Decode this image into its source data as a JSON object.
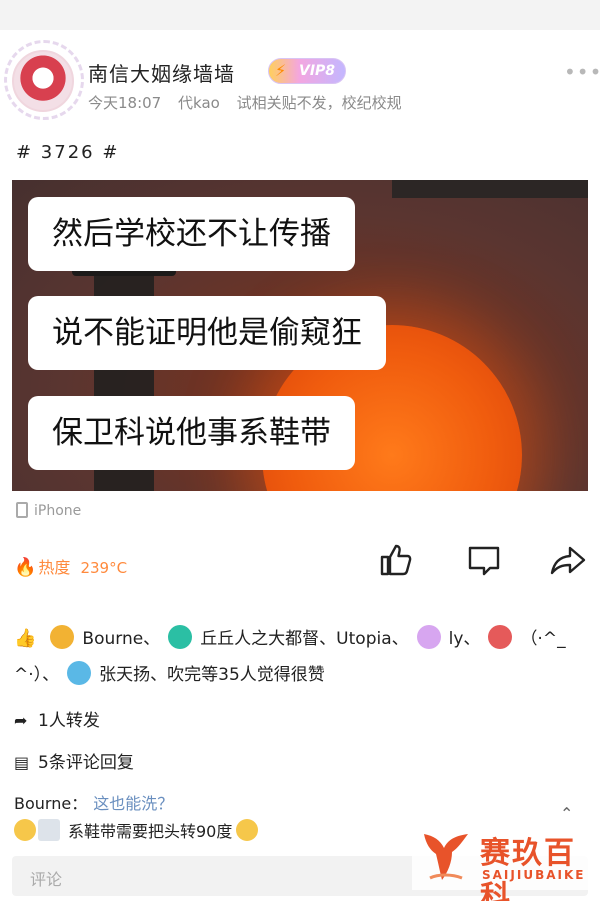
{
  "account": {
    "name": "南信大姻缘墙墙",
    "vip_label": "VIP8"
  },
  "meta": {
    "time": "今天18:07",
    "poster": "代kao",
    "note": "试相关贴不发，校纪校规"
  },
  "post": {
    "hashtag": "# 3726 #",
    "image_bubbles": [
      "然后学校还不让传播",
      "说不能证明他是偷窥狂",
      "保卫科说他事系鞋带"
    ],
    "device": "iPhone"
  },
  "stats": {
    "heat_label": "热度",
    "heat_value": "239°C"
  },
  "likes": {
    "user1": "Bourne、",
    "user2": "丘丘人之大都督、Utopia、",
    "user3": "ly、",
    "user4": "（·^_",
    "line2_start": "^·）、",
    "line2_rest": "张天扬、吹完等35人觉得很赞"
  },
  "repost": {
    "text": "1人转发"
  },
  "comments": {
    "count_text": "5条评论回复",
    "items": [
      {
        "user": "Bourne：",
        "text": "这也能洗？"
      },
      {
        "user": "",
        "text": "系鞋带需要把头转90度"
      }
    ],
    "input_placeholder": "评论"
  },
  "watermark": {
    "title": "赛玖百科",
    "subtitle": "SAIJIUBAIKE"
  },
  "colors": {
    "accent_orange": "#ff8a3d",
    "comment_link": "#6a8fbf",
    "watermark": "#e8532a"
  },
  "icons": [
    "more-icon",
    "vip-bolt-icon",
    "phone-icon",
    "fire-icon",
    "like-icon",
    "comment-icon",
    "share-icon",
    "thumb-icon",
    "repost-arrow-icon",
    "comment-list-icon"
  ]
}
